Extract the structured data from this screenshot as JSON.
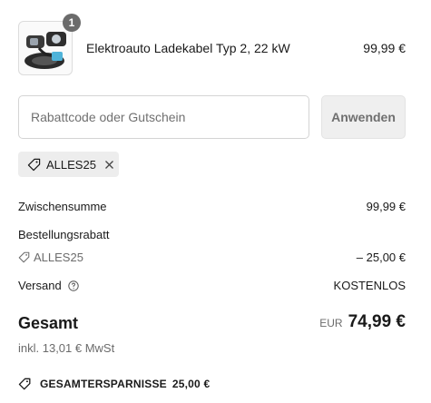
{
  "line_items": [
    {
      "name": "Elektroauto Ladekabel Typ 2, 22 kW",
      "price": "99,99 €",
      "quantity": "1"
    }
  ],
  "discount": {
    "placeholder": "Rabattcode oder Gutschein",
    "apply_label": "Anwenden",
    "applied_code": "ALLES25"
  },
  "summary": {
    "subtotal_label": "Zwischensumme",
    "subtotal_value": "99,99 €",
    "order_discount_label": "Bestellungsrabatt",
    "order_discount_code": "ALLES25",
    "order_discount_value": "– 25,00 €",
    "shipping_label": "Versand",
    "shipping_value": "KOSTENLOS",
    "total_label": "Gesamt",
    "total_currency": "EUR",
    "total_value": "74,99 €",
    "tax_note": "inkl. 13,01 € MwSt",
    "savings_label": "GESAMTERSPARNISSE",
    "savings_value": "25,00 €"
  },
  "icons": {
    "tag": "tag-icon",
    "close": "close-icon",
    "help": "question-circle-icon",
    "savings": "tag-icon"
  },
  "colors": {
    "badge": "#6b6b6b",
    "chip_bg": "#ededed",
    "button_bg": "#efefef",
    "muted_text": "#6b6b6b"
  }
}
